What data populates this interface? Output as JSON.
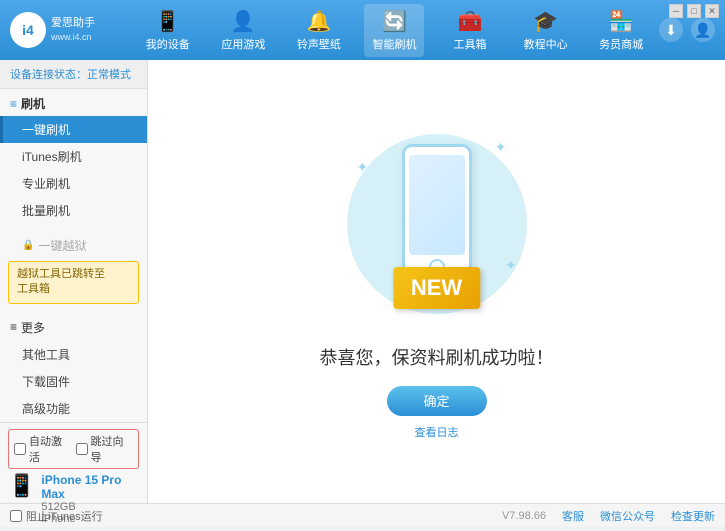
{
  "app": {
    "logo_id": "i4",
    "logo_url": "www.i4.cn",
    "title": "爱思助手"
  },
  "window_controls": {
    "minimize": "─",
    "maximize": "□",
    "close": "✕"
  },
  "nav": {
    "tabs": [
      {
        "id": "my-device",
        "icon": "📱",
        "label": "我的设备"
      },
      {
        "id": "apps-games",
        "icon": "👤",
        "label": "应用游戏"
      },
      {
        "id": "ringtones",
        "icon": "🔔",
        "label": "铃声壁纸"
      },
      {
        "id": "smart-flash",
        "icon": "🔄",
        "label": "智能刷机",
        "active": true
      },
      {
        "id": "toolbox",
        "icon": "🧰",
        "label": "工具箱"
      },
      {
        "id": "tutorial",
        "icon": "🎓",
        "label": "教程中心"
      },
      {
        "id": "service",
        "icon": "🏪",
        "label": "务员商城"
      }
    ]
  },
  "sidebar": {
    "status_label": "设备连接状态：",
    "status_value": "正常模式",
    "section_flash": "刷机",
    "items": [
      {
        "id": "one-key-flash",
        "label": "一键刷机",
        "active": true
      },
      {
        "id": "itunes-flash",
        "label": "iTunes刷机",
        "active": false
      },
      {
        "id": "pro-flash",
        "label": "专业刷机",
        "active": false
      },
      {
        "id": "batch-flash",
        "label": "批量刷机",
        "active": false
      }
    ],
    "disabled_item": "一键越狱",
    "notice_text": "越狱工具已跳转至\n工具箱",
    "section_more": "更多",
    "more_items": [
      {
        "id": "other-tools",
        "label": "其他工具"
      },
      {
        "id": "download-firmware",
        "label": "下载固件"
      },
      {
        "id": "advanced",
        "label": "高级功能"
      }
    ]
  },
  "device_options": {
    "auto_activate": "自动激活",
    "auto_guide": "跳过向导"
  },
  "device": {
    "name": "iPhone 15 Pro Max",
    "storage": "512GB",
    "type": "iPhone"
  },
  "content": {
    "new_label": "NEW",
    "success_text": "恭喜您，保资料刷机成功啦！",
    "confirm_button": "确定",
    "view_log_link": "查看日志"
  },
  "footer": {
    "itunes_label": "阻止iTunes运行",
    "version": "V7.98.66",
    "tabs": [
      "客服",
      "微信公众号",
      "检查更新"
    ]
  }
}
